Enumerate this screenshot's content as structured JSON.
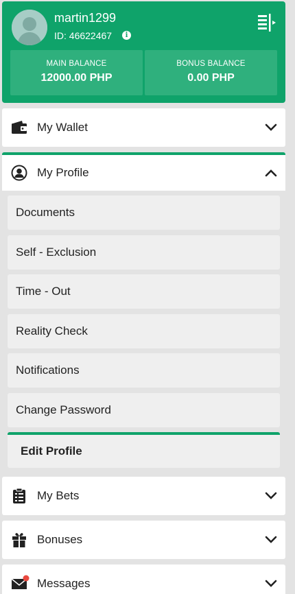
{
  "user": {
    "name": "martin1299",
    "id_text": "ID: 46622467"
  },
  "balances": [
    {
      "label": "MAIN BALANCE",
      "value": "12000.00 PHP"
    },
    {
      "label": "BONUS BALANCE",
      "value": "0.00 PHP"
    }
  ],
  "menu": {
    "wallet": "My Wallet",
    "profile": "My Profile",
    "profile_items": [
      "Documents",
      "Self - Exclusion",
      "Time - Out",
      "Reality Check",
      "Notifications",
      "Change Password",
      "Edit Profile"
    ],
    "bets": "My Bets",
    "bonuses": "Bonuses",
    "messages": "Messages"
  },
  "colors": {
    "accent": "#0fa36a",
    "balance_box": "#2fb07d",
    "badge": "#e9493f"
  }
}
